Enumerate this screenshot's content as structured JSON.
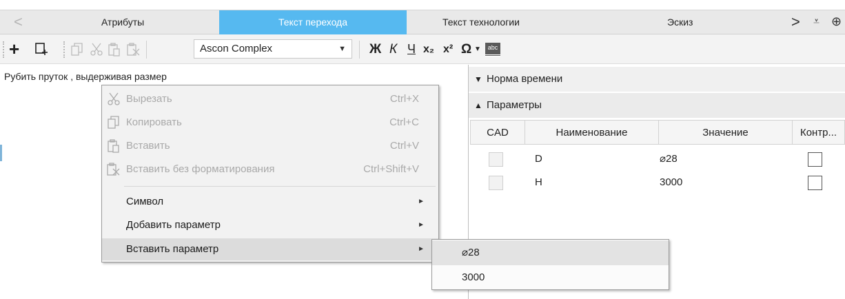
{
  "tabs": {
    "prev_arrow": "<",
    "next_arrow": ">",
    "overflow": "⩡",
    "more": "⊕",
    "items": [
      {
        "label": "Атрибуты"
      },
      {
        "label": "Текст перехода"
      },
      {
        "label": "Текст технологии"
      },
      {
        "label": "Эскиз"
      }
    ]
  },
  "toolbar": {
    "add_icon": "+",
    "font_name": "Ascon Complex",
    "bold": "Ж",
    "italic": "К",
    "underline": "Ч",
    "subscript": "x₂",
    "superscript": "x²",
    "symbol": "Ω",
    "spellcheck": "abc"
  },
  "editor": {
    "text": "Рубить пруток , выдерживая размер"
  },
  "context_menu": {
    "items": [
      {
        "label": "Вырезать",
        "shortcut": "Ctrl+X"
      },
      {
        "label": "Копировать",
        "shortcut": "Ctrl+C"
      },
      {
        "label": "Вставить",
        "shortcut": "Ctrl+V"
      },
      {
        "label": "Вставить без форматирования",
        "shortcut": "Ctrl+Shift+V"
      },
      {
        "label": "Символ"
      },
      {
        "label": "Добавить параметр"
      },
      {
        "label": "Вставить параметр"
      }
    ]
  },
  "submenu": {
    "items": [
      {
        "label": "⌀28"
      },
      {
        "label": "3000"
      }
    ]
  },
  "right_panel": {
    "section_time": "Норма времени",
    "section_params": "Параметры",
    "columns": [
      "CAD",
      "Наименование",
      "Значение",
      "Контр..."
    ],
    "rows": [
      {
        "name": "D",
        "value": "⌀28"
      },
      {
        "name": "H",
        "value": "3000"
      }
    ]
  }
}
